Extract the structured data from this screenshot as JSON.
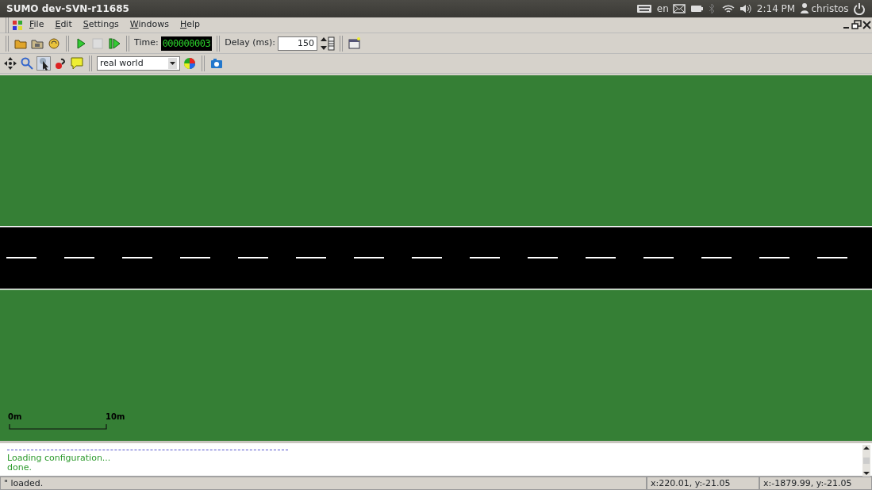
{
  "window": {
    "title": "SUMO dev-SVN-r11685"
  },
  "panel": {
    "keyboard_layout": "en",
    "time": "2:14 PM",
    "user": "christos"
  },
  "menu": [
    {
      "label": "File"
    },
    {
      "label": "Edit"
    },
    {
      "label": "Settings"
    },
    {
      "label": "Windows"
    },
    {
      "label": "Help"
    }
  ],
  "toolbar": {
    "time_label": "Time:",
    "time": "000000003",
    "delay_label": "Delay (ms):",
    "delay": "150",
    "viewport": "real world"
  },
  "view": {
    "scale_labels": [
      "0m",
      "10m"
    ]
  },
  "log": [
    {
      "text": "Loading configuration...",
      "kind": "message"
    },
    {
      "text": "done.",
      "kind": "message"
    }
  ],
  "status_bar": {
    "message": "\" loaded.",
    "cursor": "x:220.01, y:-21.05",
    "position": "x:-1879.99, y:-21.05"
  }
}
